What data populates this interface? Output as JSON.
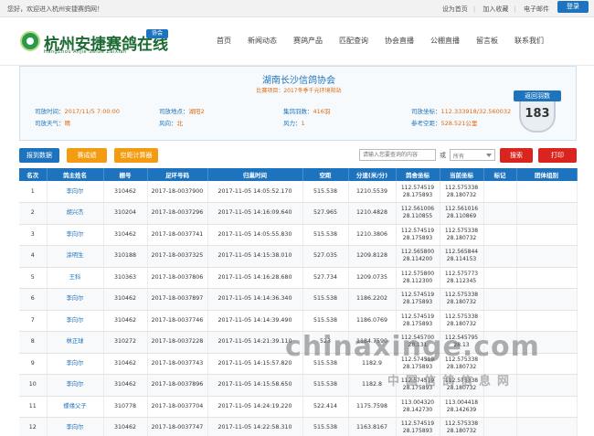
{
  "topbar": {
    "welcome": "您好，欢迎进入杭州安捷赛鸽网！",
    "links": [
      "设为首页",
      "加入收藏",
      "电子邮件"
    ],
    "login": "登录"
  },
  "logo": {
    "name": "杭州安捷赛鸽在线",
    "pinyin": "HangZhou AnJie SaiGe ZaiXian",
    "badge": "协会"
  },
  "nav": [
    "首页",
    "新闻动态",
    "赛鸽产品",
    "匹配查询",
    "协会直播",
    "公棚直播",
    "留言板",
    "联系我们"
  ],
  "race": {
    "title": "湖南长沙信鸽协会",
    "subtitle": "比赛项目：2017冬季千元环境阳站",
    "fields": [
      {
        "label": "司放时间：",
        "value": "2017/11/5 7:00:00"
      },
      {
        "label": "司放地点：",
        "value": "湖阳2"
      },
      {
        "label": "集鸽羽数：",
        "value": "416羽"
      },
      {
        "label": "司放坐标：",
        "value": "112.333918/32.560032"
      },
      {
        "label": "司放天气：",
        "value": "晴"
      },
      {
        "label": "风向：",
        "value": "北"
      },
      {
        "label": "风力：",
        "value": "1"
      },
      {
        "label": "参考空距：",
        "value": "528.521公里"
      }
    ],
    "returned_label": "返回羽数",
    "returned_count": "183"
  },
  "toolbar": {
    "report_btn": "报到数据",
    "rank_btn": "赛成绩",
    "distance_btn": "空距计算器",
    "search_placeholder": "请输入您要查询的内容",
    "or_label": "或",
    "select_value": "所有",
    "search_btn": "搜索",
    "print_btn": "打印"
  },
  "colors": {
    "primary": "#1e73be",
    "orange": "#f39c12",
    "red": "#d9251d",
    "accent_text": "#e06a10"
  },
  "table": {
    "headers": [
      "名次",
      "鸽主姓名",
      "棚号",
      "足环号码",
      "归巢时间",
      "空距",
      "分速(米/分)",
      "鸽舍坐标",
      "当前坐标",
      "标记",
      "团体组别"
    ],
    "rows": [
      [
        "1",
        "李向尔",
        "310462",
        "2017-18-0037900",
        "2017-11-05 14:05:52.170",
        "515.538",
        "1210.5539",
        "112.574519\n28.175893",
        "112.575338\n28.180732",
        "",
        ""
      ],
      [
        "2",
        "胡兴杰",
        "310204",
        "2017-18-0037296",
        "2017-11-05 14:16:09.640",
        "527.965",
        "1210.4828",
        "112.561006\n28.110855",
        "112.561016\n28.110869",
        "",
        ""
      ],
      [
        "3",
        "李向尔",
        "310462",
        "2017-18-0037741",
        "2017-11-05 14:05:55.830",
        "515.538",
        "1210.3806",
        "112.574519\n28.175893",
        "112.575338\n28.180732",
        "",
        ""
      ],
      [
        "4",
        "涂明生",
        "310188",
        "2017-18-0037325",
        "2017-11-05 14:15:38.010",
        "527.035",
        "1209.8128",
        "112.565800\n28.114200",
        "112.565844\n28.114153",
        "",
        ""
      ],
      [
        "5",
        "王科",
        "310363",
        "2017-18-0037806",
        "2017-11-05 14:16:28.680",
        "527.734",
        "1209.0735",
        "112.575800\n28.112300",
        "112.575773\n28.112345",
        "",
        ""
      ],
      [
        "6",
        "李向尔",
        "310462",
        "2017-18-0037897",
        "2017-11-05 14:14:36.340",
        "515.538",
        "1186.2202",
        "112.574519\n28.175893",
        "112.575338\n28.180732",
        "",
        ""
      ],
      [
        "7",
        "李向尔",
        "310462",
        "2017-18-0037746",
        "2017-11-05 14:14:39.490",
        "515.538",
        "1186.0769",
        "112.574519\n28.175893",
        "112.575338\n28.180732",
        "",
        ""
      ],
      [
        "8",
        "林正球",
        "310272",
        "2017-18-0037228",
        "2017-11-05 14:21:39.110",
        "523",
        "1184.7590",
        "112.545700\n28.131",
        "112.545795\n28.13",
        "",
        ""
      ],
      [
        "9",
        "李向尔",
        "310462",
        "2017-18-0037743",
        "2017-11-05 14:15:57.820",
        "515.538",
        "1182.9",
        "112.574519\n28.175893",
        "112.575338\n28.180732",
        "",
        ""
      ],
      [
        "10",
        "李向尔",
        "310462",
        "2017-18-0037896",
        "2017-11-05 14:15:58.650",
        "515.538",
        "1182.8",
        "112.574519\n28.175893",
        "112.575338\n28.180732",
        "",
        ""
      ],
      [
        "11",
        "蝶缘父子",
        "310778",
        "2017-18-0037704",
        "2017-11-05 14:24:19.220",
        "522.414",
        "1175.7598",
        "113.004320\n28.142730",
        "113.004418\n28.142639",
        "",
        ""
      ],
      [
        "12",
        "李向尔",
        "310462",
        "2017-18-0037747",
        "2017-11-05 14:22:58.310",
        "515.538",
        "1163.8167",
        "112.574519\n28.175893",
        "112.575338\n28.180732",
        "",
        ""
      ]
    ]
  },
  "watermark": {
    "line1": "chinaxinge.com",
    "line2": "中国信鸽信息网"
  }
}
